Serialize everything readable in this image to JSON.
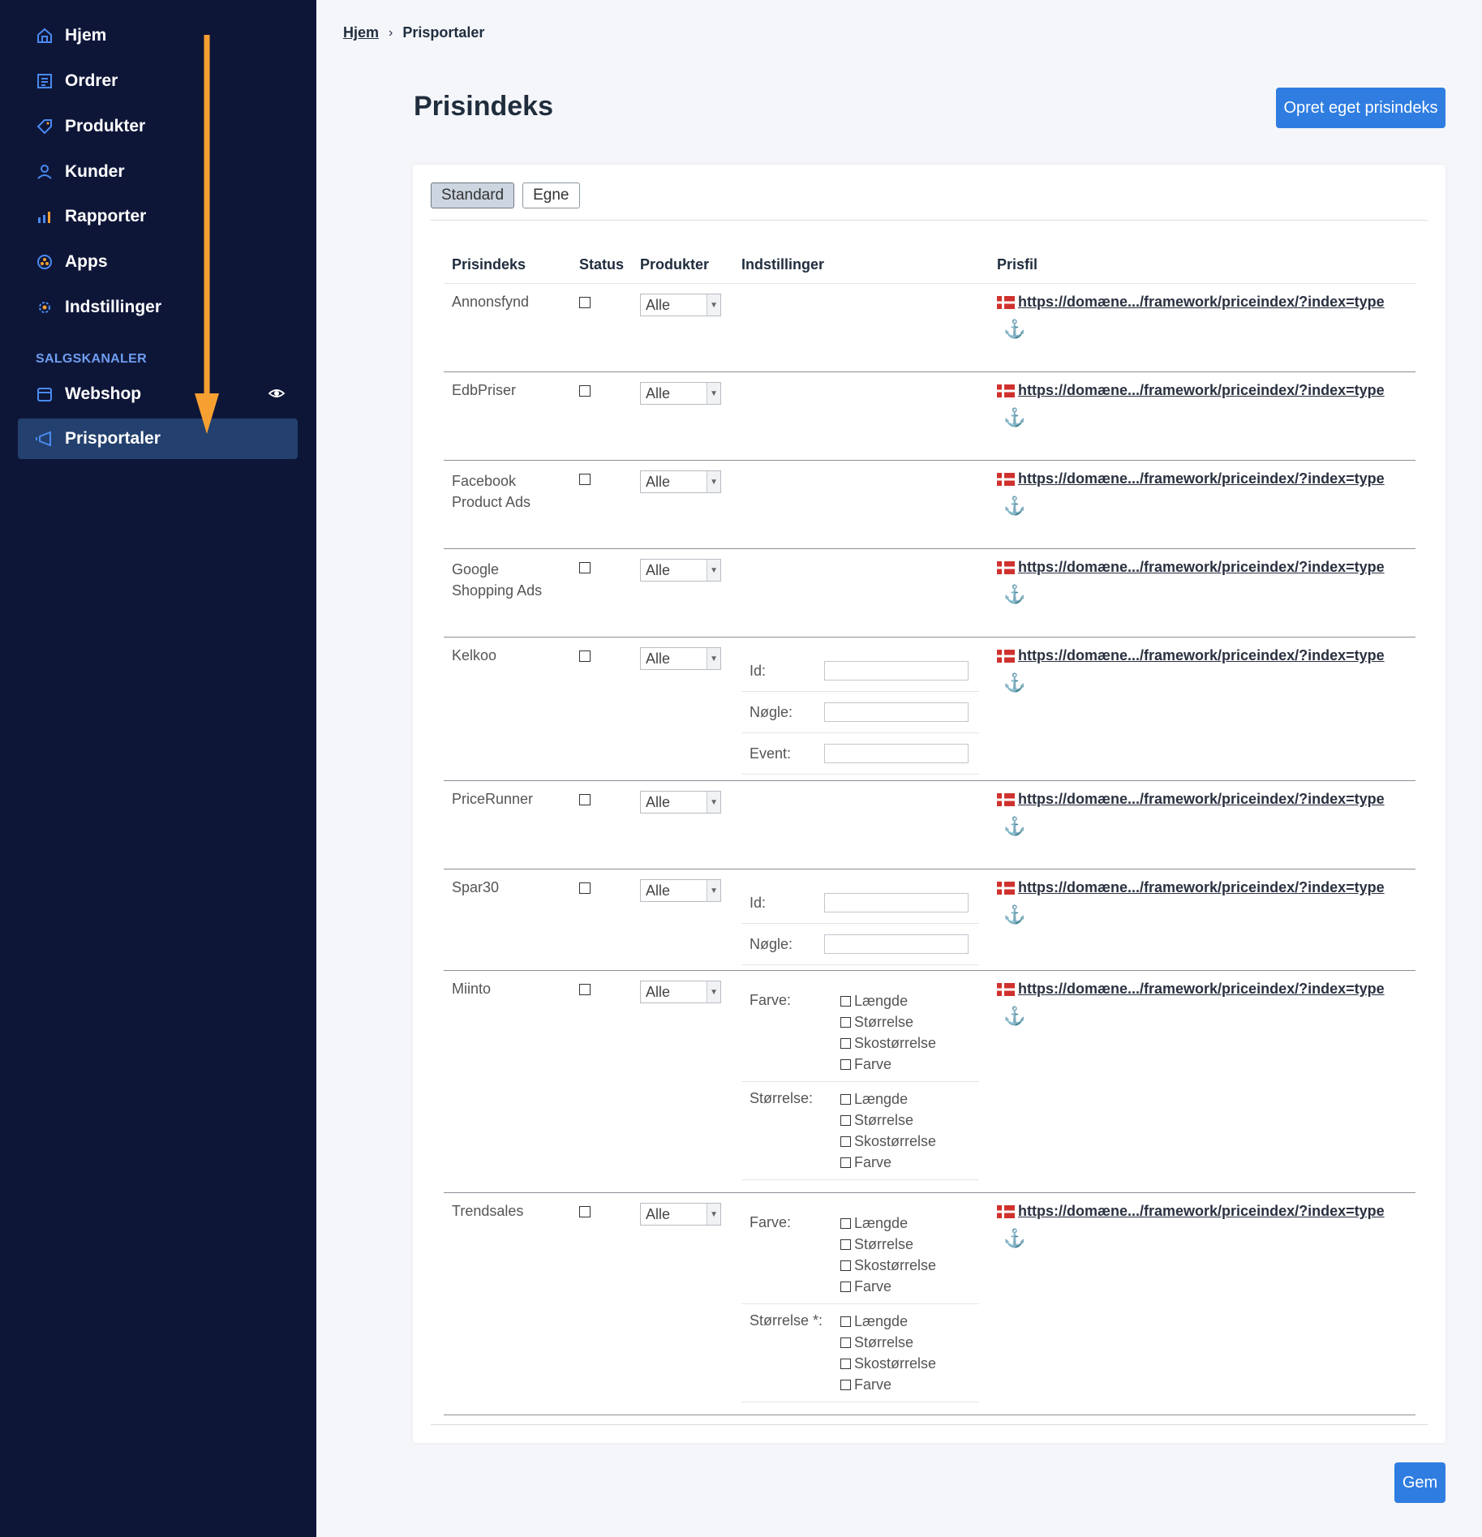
{
  "sidebar": {
    "items": [
      {
        "label": "Hjem",
        "icon": "home-icon"
      },
      {
        "label": "Ordrer",
        "icon": "orders-icon"
      },
      {
        "label": "Produkter",
        "icon": "tag-icon"
      },
      {
        "label": "Kunder",
        "icon": "user-icon"
      },
      {
        "label": "Rapporter",
        "icon": "bar-chart-icon"
      },
      {
        "label": "Apps",
        "icon": "apps-icon"
      },
      {
        "label": "Indstillinger",
        "icon": "gear-icon"
      }
    ],
    "section_label": "SALGSKANALER",
    "channels": [
      {
        "label": "Webshop",
        "icon": "store-icon"
      },
      {
        "label": "Prisportaler",
        "icon": "megaphone-icon"
      }
    ],
    "accent_color": "#4a8af0",
    "active_bg": "#23406e",
    "annotation_arrow_color": "#f5a031"
  },
  "breadcrumb": {
    "home": "Hjem",
    "separator": "›",
    "current": "Prisportaler"
  },
  "page_title": "Prisindeks",
  "create_button": "Opret eget prisindeks",
  "save_button": "Gem",
  "tabs": {
    "standard": "Standard",
    "own": "Egne"
  },
  "table": {
    "headers": {
      "name": "Prisindeks",
      "status": "Status",
      "products": "Produkter",
      "settings": "Indstillinger",
      "file": "Prisfil"
    },
    "select_value": "Alle",
    "link_text": "https://domæne.../framework/priceindex/?index=type",
    "anchor_glyph": "⚓",
    "option_labels": [
      "Længde",
      "Størrelse",
      "Skostørrelse",
      "Farve"
    ],
    "rows": [
      {
        "name": "Annonsfynd"
      },
      {
        "name": "EdbPriser"
      },
      {
        "name_lines": [
          "Facebook",
          "Product Ads"
        ]
      },
      {
        "name_lines": [
          "Google",
          "Shopping Ads"
        ]
      },
      {
        "name": "Kelkoo",
        "fields": [
          "Id:",
          "Nøgle:",
          "Event:"
        ]
      },
      {
        "name": "PriceRunner"
      },
      {
        "name": "Spar30",
        "fields": [
          "Id:",
          "Nøgle:"
        ]
      },
      {
        "name": "Miinto",
        "groups": [
          "Farve:",
          "Størrelse:"
        ]
      },
      {
        "name": "Trendsales",
        "groups": [
          "Farve:",
          "Størrelse *:"
        ]
      }
    ]
  }
}
